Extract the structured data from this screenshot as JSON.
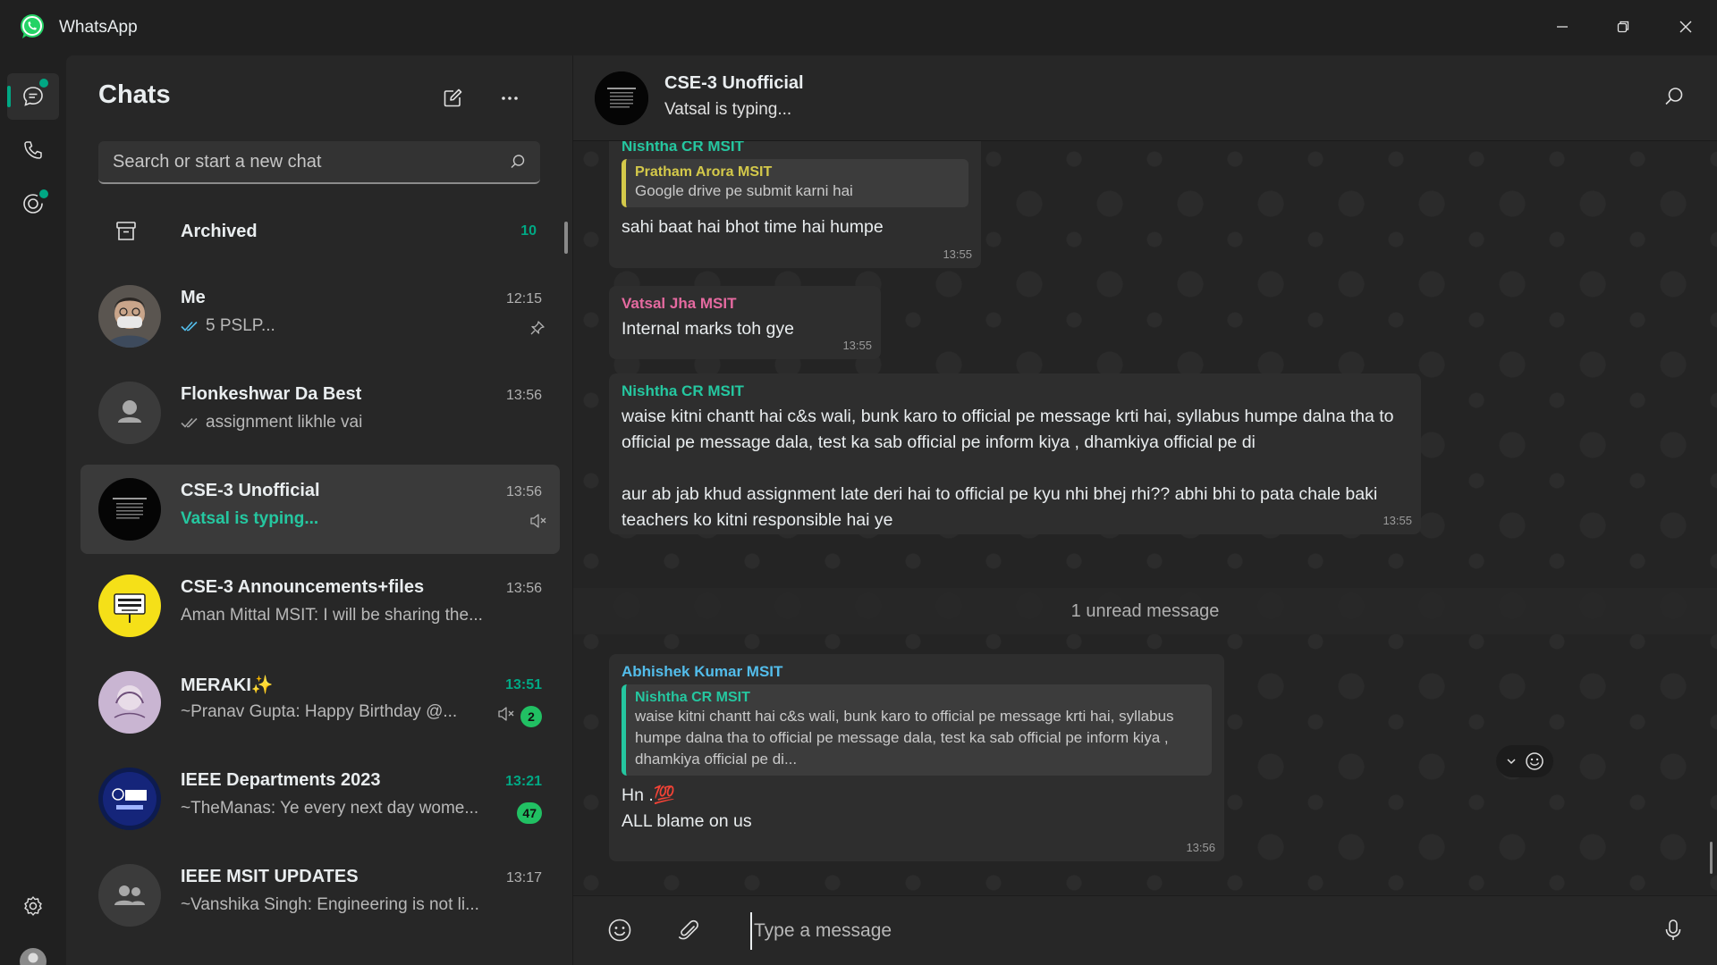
{
  "app": {
    "title": "WhatsApp",
    "accent": "#00a884"
  },
  "window_controls": {
    "minimize": "minimize-icon",
    "maximize": "maximize-icon",
    "close": "close-icon"
  },
  "rail": {
    "items": [
      "chats-icon",
      "calls-icon",
      "status-icon",
      "settings-icon",
      "profile-icon"
    ]
  },
  "chat_list": {
    "title": "Chats",
    "search_placeholder": "Search or start a new chat",
    "archived": {
      "label": "Archived",
      "count": "10"
    },
    "chats": [
      {
        "name": "Me",
        "time": "12:15",
        "preview": "5 PSLP...",
        "pinned": true
      },
      {
        "name": "Flonkeshwar Da Best",
        "time": "13:56",
        "preview": "assignment likhle vai"
      },
      {
        "name": "CSE-3 Unofficial",
        "time": "13:56",
        "preview": "Vatsal is typing...",
        "muted": true
      },
      {
        "name": "CSE-3 Announcements+files",
        "time": "13:56",
        "preview": "Aman Mittal MSIT: I will be sharing the..."
      },
      {
        "name": "MERAKI✨",
        "time": "13:51",
        "preview": "~Pranav Gupta: Happy Birthday @...",
        "unread": "2",
        "muted": true
      },
      {
        "name": "IEEE Departments 2023",
        "time": "13:21",
        "preview": "~TheManas: Ye every next day wome...",
        "unread": "47"
      },
      {
        "name": "IEEE MSIT UPDATES",
        "time": "13:17",
        "preview": "~Vanshika Singh: Engineering is not li..."
      }
    ]
  },
  "conversation": {
    "name": "CSE-3 Unofficial",
    "status": "Vatsal is typing...",
    "messages": [
      {
        "sender": "Nishtha CR MSIT",
        "quote_sender": "Pratham Arora MSIT",
        "quote_text": "Google drive pe submit karni hai",
        "text": "sahi baat hai bhot time hai humpe",
        "time": "13:55"
      },
      {
        "sender": "Vatsal Jha MSIT",
        "text": "Internal marks toh gye",
        "time": "13:55"
      },
      {
        "sender": "Nishtha CR MSIT",
        "text": "waise kitni chantt hai c&s wali, bunk karo to official pe message krti hai, syllabus humpe dalna tha to official pe message dala, test ka sab official pe inform kiya , dhamkiya official pe di\n\naur ab jab khud assignment late deri hai to official pe kyu nhi bhej rhi?? abhi bhi to pata chale baki teachers ko kitni responsible hai ye",
        "time": "13:55"
      },
      {
        "sender": "Abhishek Kumar MSIT",
        "quote_sender": "Nishtha CR MSIT",
        "quote_text": "waise kitni chantt hai c&s wali, bunk karo to official pe message krti hai, syllabus humpe dalna tha to official pe message dala, test ka sab official pe inform kiya , dhamkiya official pe di...",
        "text": "Hn .💯\nALL blame on us",
        "time": "13:56"
      }
    ],
    "unread_divider": "1 unread message",
    "composer_placeholder": "Type a message"
  },
  "sender_colors": {
    "Nishtha CR MSIT": "#25c7a0",
    "Pratham Arora MSIT": "#d4c94a",
    "Vatsal Jha MSIT": "#e56aa0",
    "Abhishek Kumar MSIT": "#53bdeb"
  }
}
